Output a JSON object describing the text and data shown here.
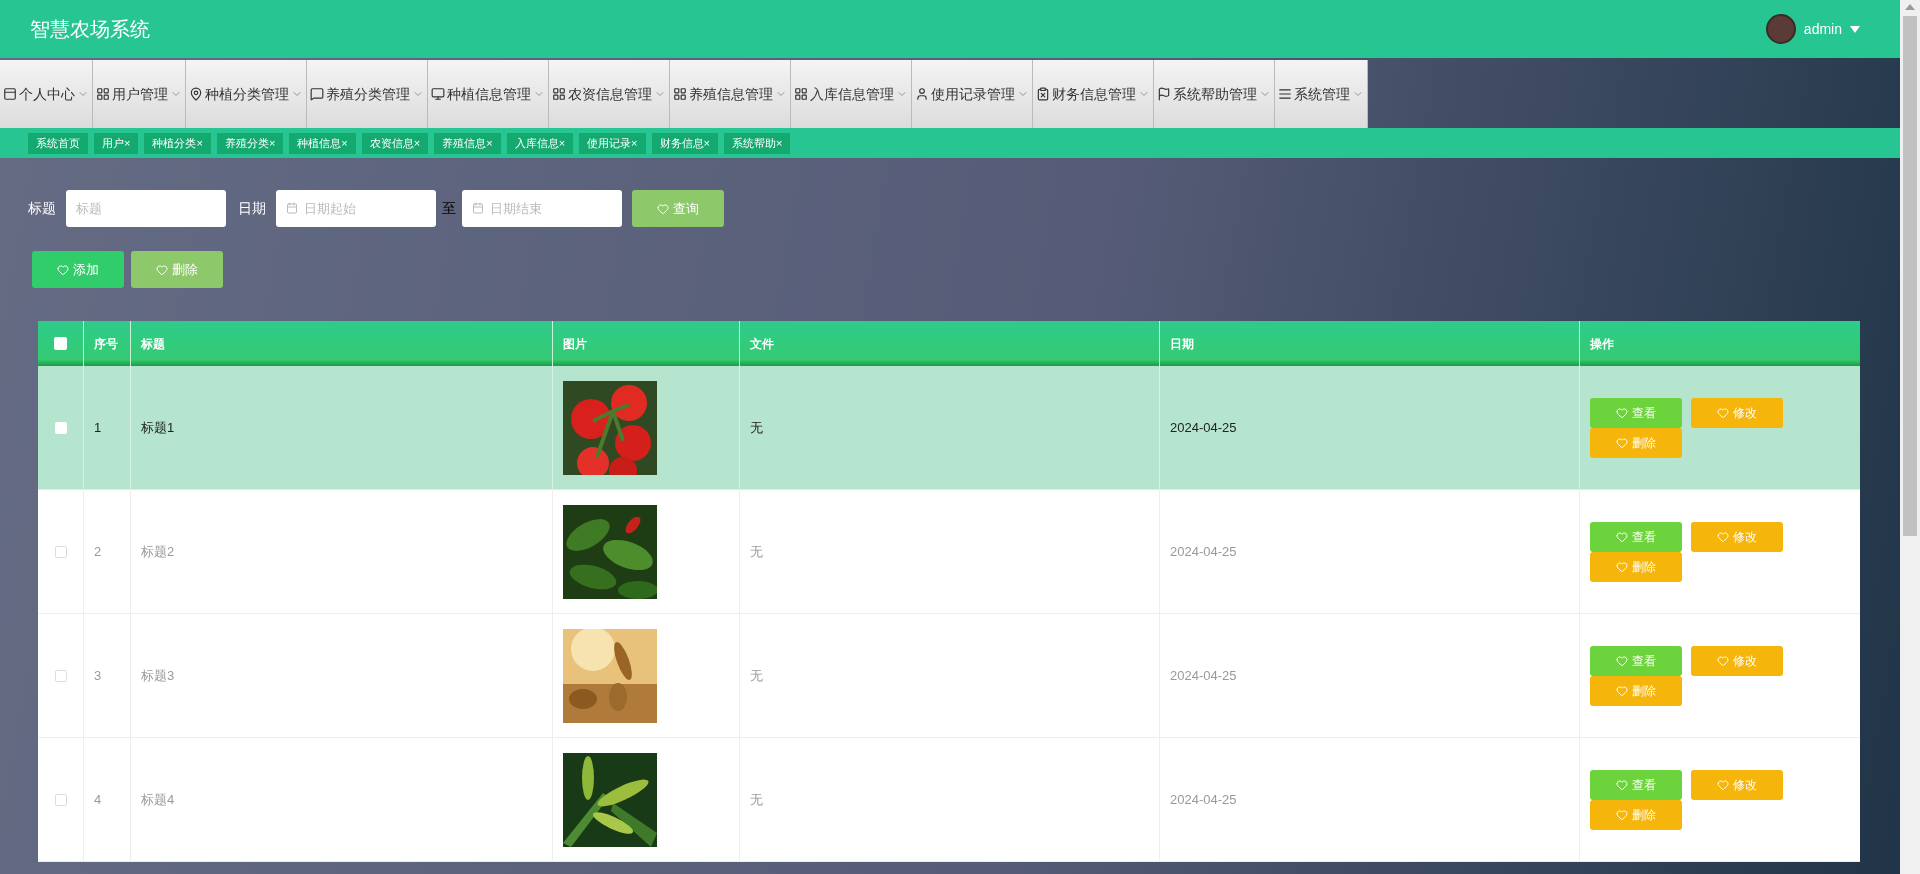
{
  "header": {
    "title": "智慧农场系统",
    "user": "admin"
  },
  "nav": [
    {
      "label": "个人中心"
    },
    {
      "label": "用户管理"
    },
    {
      "label": "种植分类管理"
    },
    {
      "label": "养殖分类管理"
    },
    {
      "label": "种植信息管理"
    },
    {
      "label": "农资信息管理"
    },
    {
      "label": "养殖信息管理"
    },
    {
      "label": "入库信息管理"
    },
    {
      "label": "使用记录管理"
    },
    {
      "label": "财务信息管理"
    },
    {
      "label": "系统帮助管理"
    },
    {
      "label": "系统管理"
    }
  ],
  "tags": [
    {
      "label": "系统首页"
    },
    {
      "label": "用户",
      "close": "×"
    },
    {
      "label": "种植分类",
      "close": "×"
    },
    {
      "label": "养殖分类",
      "close": "×"
    },
    {
      "label": "种植信息",
      "close": "×"
    },
    {
      "label": "农资信息",
      "close": "×"
    },
    {
      "label": "养殖信息",
      "close": "×"
    },
    {
      "label": "入库信息",
      "close": "×"
    },
    {
      "label": "使用记录",
      "close": "×"
    },
    {
      "label": "财务信息",
      "close": "×"
    },
    {
      "label": "系统帮助",
      "close": "×"
    }
  ],
  "filter": {
    "title_label": "标题",
    "title_placeholder": "标题",
    "date_label": "日期",
    "start_placeholder": "日期起始",
    "to": "至",
    "end_placeholder": "日期结束",
    "query": "查询"
  },
  "actions": [
    "添加",
    "删除"
  ],
  "table": {
    "select_all_checked": false,
    "columns": [
      "序号",
      "标题",
      "图片",
      "文件",
      "日期",
      "操作"
    ],
    "rows": [
      {
        "selected": true,
        "no": "1",
        "title": "标题1",
        "picture": {
          "kind": "picture"
        },
        "file": "无",
        "date": "2024-04-25",
        "buttons": [
          "查看",
          "修改",
          "删除"
        ]
      },
      {
        "selected": false,
        "no": "2",
        "title": "标题2",
        "picture": {
          "kind": "picture"
        },
        "file": "无",
        "date": "2024-04-25",
        "buttons": [
          "查看",
          "修改",
          "删除"
        ]
      },
      {
        "selected": false,
        "no": "3",
        "title": "标题3",
        "picture": {
          "kind": "picture"
        },
        "file": "无",
        "date": "2024-04-25",
        "buttons": [
          "查看",
          "修改",
          "删除"
        ]
      },
      {
        "selected": false,
        "no": "4",
        "title": "标题4",
        "picture": {
          "kind": "picture"
        },
        "file": "无",
        "date": "2024-04-25",
        "buttons": [
          "查看",
          "修改",
          "删除"
        ]
      }
    ]
  }
}
